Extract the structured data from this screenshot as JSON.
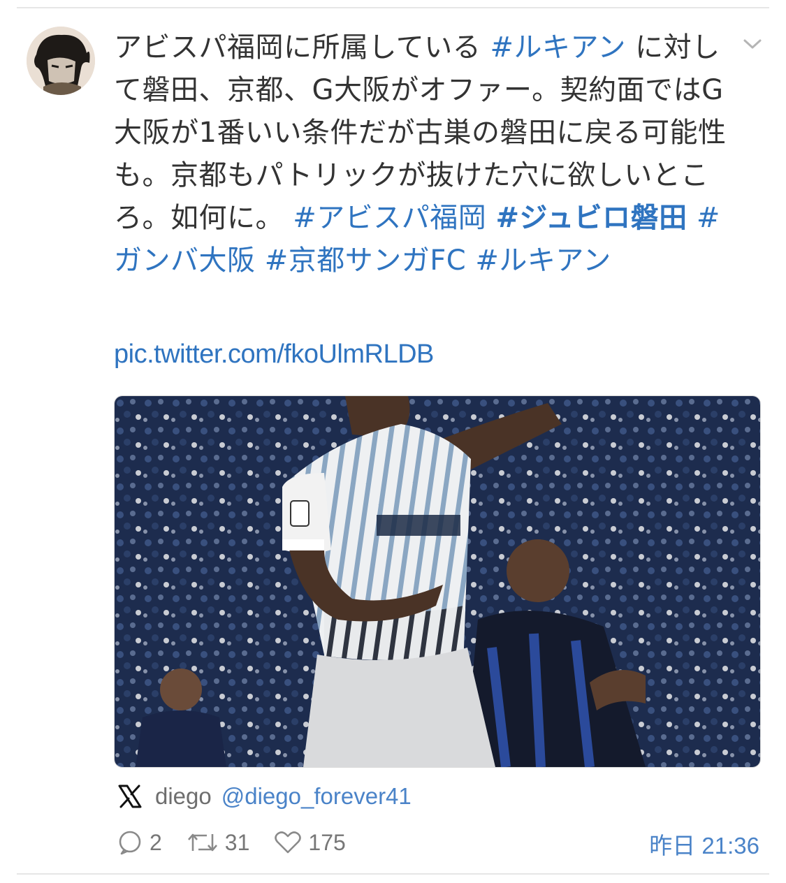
{
  "tweet": {
    "text_segments": [
      {
        "text": "アビスパ福岡に所属している ",
        "type": "plain"
      },
      {
        "text": "#ルキアン",
        "type": "tag"
      },
      {
        "text": " に対して磐田、京都、G大阪がオファー。契約面ではG大阪が1番いい条件だが古巣の磐田に戻る可能性も。京都もパトリックが抜けた穴に欲しいところ。如何に。 ",
        "type": "plain"
      },
      {
        "text": "#アビスパ福岡",
        "type": "tag"
      },
      {
        "text": " ",
        "type": "plain"
      },
      {
        "text": "#ジュビロ磐田",
        "type": "tag-bold"
      },
      {
        "text": " ",
        "type": "plain"
      },
      {
        "text": "#ガンバ大阪",
        "type": "tag"
      },
      {
        "text": " ",
        "type": "plain"
      },
      {
        "text": "#京都サンガFC",
        "type": "tag"
      },
      {
        "text": " ",
        "type": "plain"
      },
      {
        "text": "#ルキアン",
        "type": "tag"
      }
    ],
    "pic_link": "pic.twitter.com/fkoUlmRLDB"
  },
  "author": {
    "name": "diego",
    "handle": "@diego_forever41",
    "platform_icon": "x-logo-icon"
  },
  "stats": {
    "replies": "2",
    "retweets": "31",
    "likes": "175"
  },
  "timestamp": "昨日 21:36",
  "colors": {
    "link": "#2f74c0",
    "text": "#333333",
    "meta": "#777777"
  }
}
